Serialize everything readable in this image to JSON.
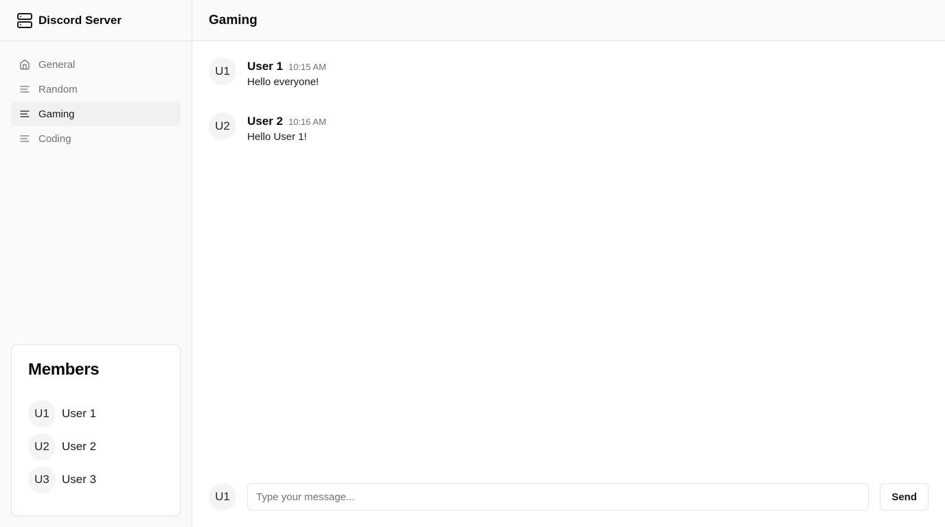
{
  "server": {
    "title": "Discord Server",
    "icon": "server-icon"
  },
  "channels": [
    {
      "label": "General",
      "icon": "home-icon",
      "active": false
    },
    {
      "label": "Random",
      "icon": "text-align-icon",
      "active": false
    },
    {
      "label": "Gaming",
      "icon": "text-align-icon",
      "active": true
    },
    {
      "label": "Coding",
      "icon": "text-align-icon",
      "active": false
    }
  ],
  "members": {
    "title": "Members",
    "items": [
      {
        "avatar": "U1",
        "name": "User 1"
      },
      {
        "avatar": "U2",
        "name": "User 2"
      },
      {
        "avatar": "U3",
        "name": "User 3"
      }
    ]
  },
  "main": {
    "channel_title": "Gaming",
    "messages": [
      {
        "avatar": "U1",
        "author": "User 1",
        "time": "10:15 AM",
        "text": "Hello everyone!"
      },
      {
        "avatar": "U2",
        "author": "User 2",
        "time": "10:16 AM",
        "text": "Hello User 1!"
      }
    ]
  },
  "composer": {
    "avatar": "U1",
    "placeholder": "Type your message...",
    "value": "",
    "send_label": "Send"
  },
  "colors": {
    "sidebar_bg": "#fafafa",
    "active_channel_bg": "#f1f1f3",
    "border": "#e4e4e7",
    "muted_text": "#71717a"
  }
}
